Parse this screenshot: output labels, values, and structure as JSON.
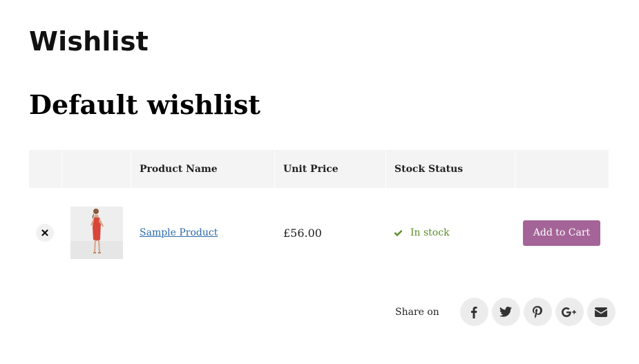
{
  "page": {
    "title": "Wishlist"
  },
  "wishlist": {
    "title": "Default wishlist"
  },
  "table": {
    "headers": {
      "remove": "",
      "thumbnail": "",
      "product_name": "Product Name",
      "unit_price": "Unit Price",
      "stock_status": "Stock Status",
      "action": ""
    },
    "rows": [
      {
        "product_name": "Sample Product",
        "unit_price": "£56.00",
        "stock_status": "In stock",
        "action_label": "Add to Cart",
        "remove_icon": "close-icon",
        "stock_icon": "check-icon"
      }
    ]
  },
  "share": {
    "label": "Share on",
    "icons": [
      "facebook-icon",
      "twitter-icon",
      "pinterest-icon",
      "google-plus-icon",
      "email-icon"
    ]
  },
  "colors": {
    "link": "#2b6aa8",
    "in_stock": "#5b8c2a",
    "button": "#a46497",
    "header_bg": "#f4f4f4",
    "share_bg": "#ececec"
  }
}
